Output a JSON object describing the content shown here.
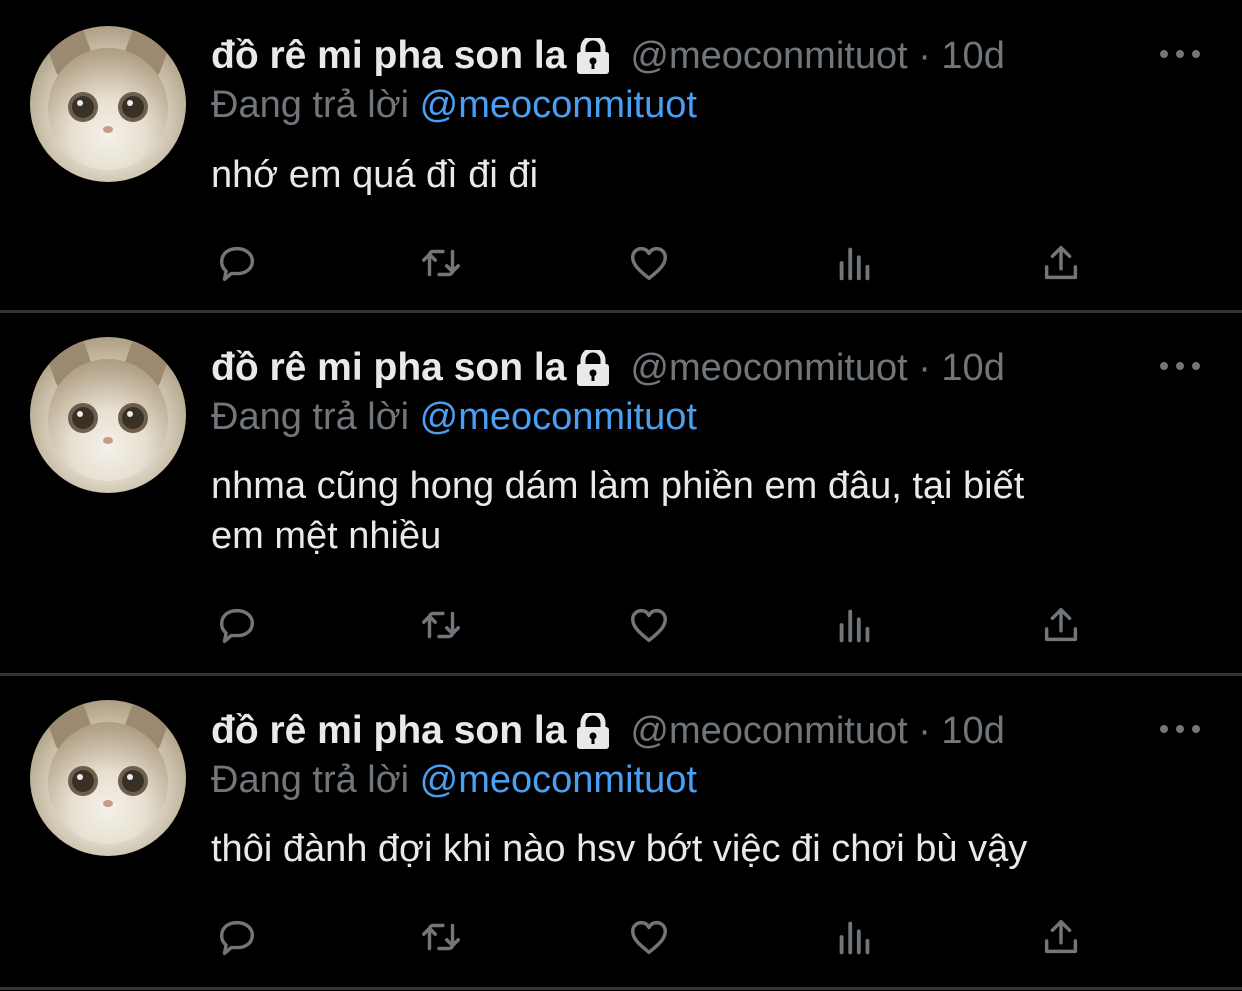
{
  "tweets": [
    {
      "name": "đồ rê mi pha son la",
      "handle_time": "@meoconmituot · 10d",
      "reply_prefix": "Đang trả lời",
      "reply_mention": "@meoconmituot",
      "text": "nhớ em quá đì đi đi"
    },
    {
      "name": "đồ rê mi pha son la",
      "handle_time": "@meoconmituot · 10d",
      "reply_prefix": "Đang trả lời",
      "reply_mention": "@meoconmituot",
      "text": "nhma cũng hong dám làm phiền em đâu, tại biết\nem mệt nhiều"
    },
    {
      "name": "đồ rê mi pha son la",
      "handle_time": "@meoconmituot · 10d",
      "reply_prefix": "Đang trả lời",
      "reply_mention": "@meoconmituot",
      "text": "thôi đành đợi khi nào hsv bớt việc đi chơi bù vậy"
    }
  ],
  "icons": {
    "protected": "lock-icon",
    "more": "more-icon",
    "reply": "reply-icon",
    "retweet": "retweet-icon",
    "like": "like-icon",
    "views": "views-icon",
    "share": "share-icon"
  },
  "colors": {
    "background": "#000000",
    "text": "#e7e9ea",
    "muted": "#71767b",
    "mention": "#4a9ff2",
    "divider": "#2f3336"
  }
}
